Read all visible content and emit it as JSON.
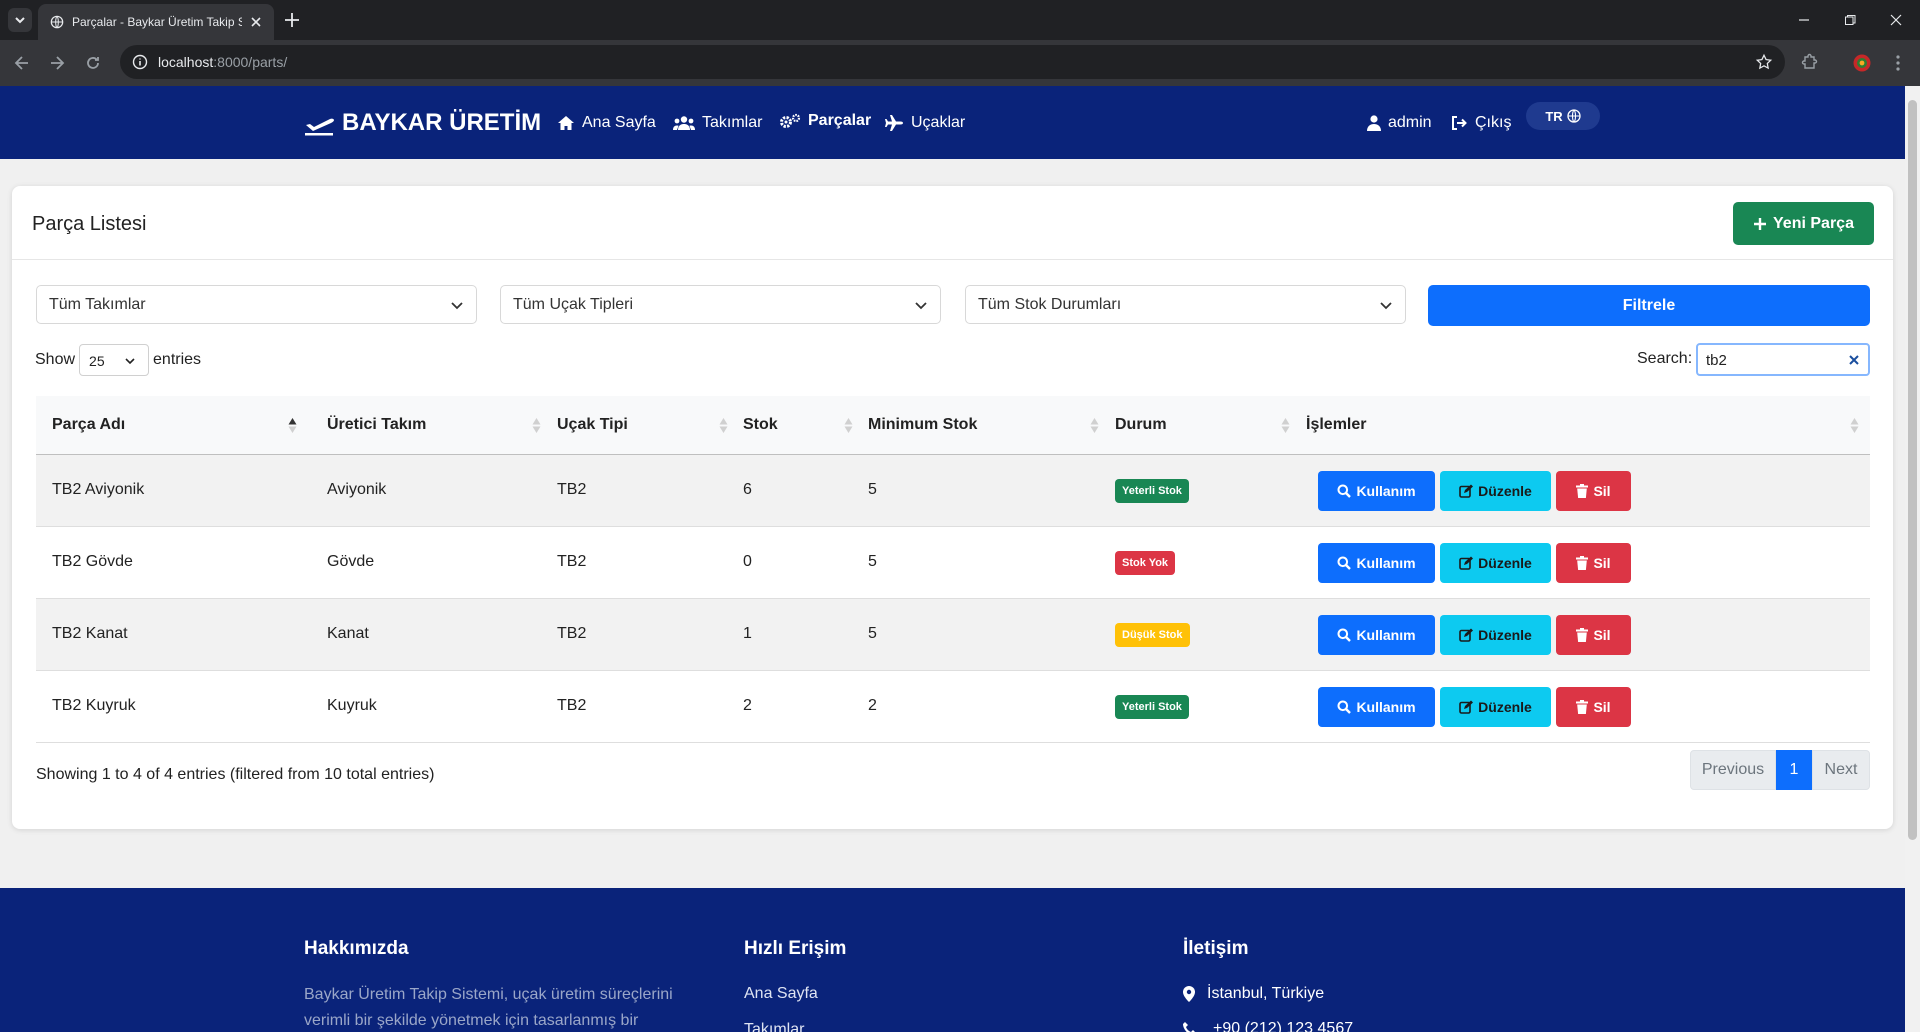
{
  "browser": {
    "tab_title": "Parçalar - Baykar Üretim Takip Sistemi",
    "url_host": "localhost",
    "url_path": ":8000/parts/"
  },
  "nav": {
    "brand": "BAYKAR ÜRETİM",
    "links": [
      {
        "label": "Ana Sayfa",
        "icon": "home-icon"
      },
      {
        "label": "Takımlar",
        "icon": "users-icon"
      },
      {
        "label": "Parçalar",
        "icon": "cogs-icon"
      },
      {
        "label": "Uçaklar",
        "icon": "plane-icon"
      }
    ],
    "user": "admin",
    "logout": "Çıkış",
    "lang": "TR",
    "colors": {
      "navbar": "#0a237a"
    }
  },
  "card": {
    "title": "Parça Listesi",
    "new_button": "Yeni Parça"
  },
  "filters": {
    "team": "Tüm Takımlar",
    "aircraft": "Tüm Uçak Tipleri",
    "stock": "Tüm Stok Durumları",
    "filter_button": "Filtrele"
  },
  "datatable": {
    "show_label": "Show",
    "entries_label": "entries",
    "page_length": "25",
    "search_label": "Search:",
    "search_value": "tb2",
    "columns": [
      "Parça Adı",
      "Üretici Takım",
      "Uçak Tipi",
      "Stok",
      "Minimum Stok",
      "Durum",
      "İşlemler"
    ],
    "rows": [
      {
        "name": "TB2 Aviyonik",
        "team": "Aviyonik",
        "aircraft": "TB2",
        "stock": "6",
        "min_stock": "5",
        "status": "Yeterli Stok",
        "status_color": "#198754"
      },
      {
        "name": "TB2 Gövde",
        "team": "Gövde",
        "aircraft": "TB2",
        "stock": "0",
        "min_stock": "5",
        "status": "Stok Yok",
        "status_color": "#dc3545"
      },
      {
        "name": "TB2 Kanat",
        "team": "Kanat",
        "aircraft": "TB2",
        "stock": "1",
        "min_stock": "5",
        "status": "Düşük Stok",
        "status_color": "#ffc107"
      },
      {
        "name": "TB2 Kuyruk",
        "team": "Kuyruk",
        "aircraft": "TB2",
        "stock": "2",
        "min_stock": "2",
        "status": "Yeterli Stok",
        "status_color": "#198754"
      }
    ],
    "actions": {
      "use": "Kullanım",
      "edit": "Düzenle",
      "delete": "Sil"
    },
    "info": "Showing 1 to 4 of 4 entries (filtered from 10 total entries)",
    "pager": {
      "previous": "Previous",
      "current": "1",
      "next": "Next"
    }
  },
  "footer": {
    "about_title": "Hakkımızda",
    "about_text": "Baykar Üretim Takip Sistemi, uçak üretim süreçlerini verimli bir şekilde yönetmek için tasarlanmış bir",
    "quick_title": "Hızlı Erişim",
    "quick_links": [
      "Ana Sayfa",
      "Takımlar"
    ],
    "contact_title": "İletişim",
    "address": "İstanbul, Türkiye",
    "phone": "+90 (212) 123 4567"
  }
}
